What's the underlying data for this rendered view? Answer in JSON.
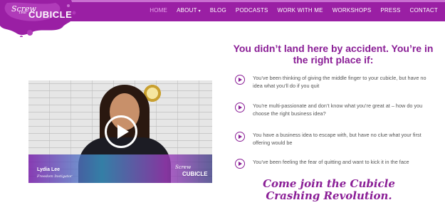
{
  "logo": {
    "line1": "Screw",
    "line2": "THE",
    "line3": "CUBICLE",
    "splash_color": "#9a1fa4"
  },
  "nav": {
    "items": [
      {
        "label": "HOME",
        "active": true
      },
      {
        "label": "ABOUT",
        "has_dropdown": true
      },
      {
        "label": "BLOG"
      },
      {
        "label": "PODCASTS"
      },
      {
        "label": "WORK WITH ME"
      },
      {
        "label": "WORKSHOPS"
      },
      {
        "label": "PRESS"
      },
      {
        "label": "CONTACT"
      }
    ],
    "caret_icon": "chevron-down-icon"
  },
  "heading": "You didn’t land here by accident.  You’re in the right place if:",
  "list": [
    "You’ve been thinking of giving the middle finger to your cubicle, but have no idea what you’ll do if you quit",
    "You’re multi-passionate and don’t know what you’re great at – how do you choose the right business idea?",
    "You have a business idea to escape with, but have no clue what your first offering would be",
    "You’ve been feeling the fear of quitting and want to kick it in the face"
  ],
  "video": {
    "name": "Lydia Lee",
    "title": "Freedom Instigator",
    "logo_line1": "Screw",
    "logo_line2": "CUBICLE"
  },
  "cta": "Come join the Cubicle Crashing Revolution.",
  "colors": {
    "brand_purple": "#9a1fa4",
    "heading_purple": "#8a1e96",
    "body_text": "#555555"
  }
}
